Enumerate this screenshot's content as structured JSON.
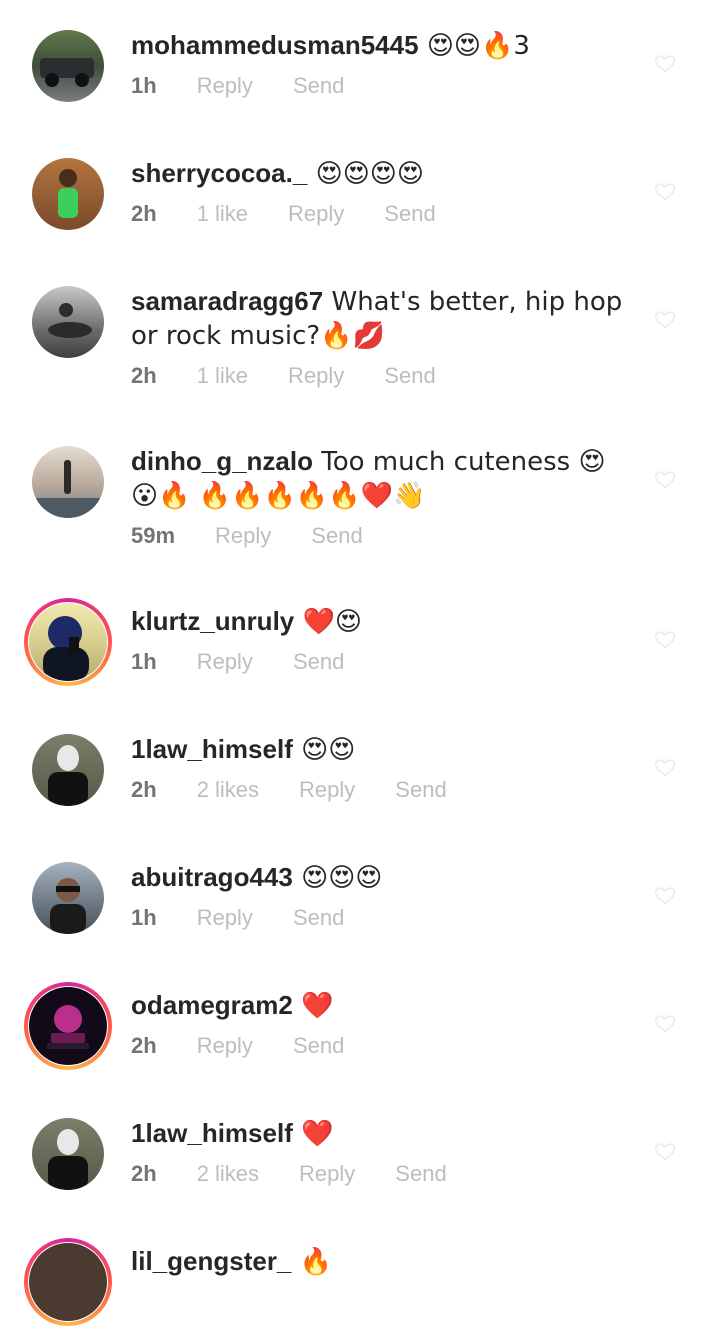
{
  "comments": [
    {
      "username": "mohammedusman5445",
      "text": " 😍😍🔥3",
      "time": "1h",
      "likes": "",
      "reply": "Reply",
      "send": "Send"
    },
    {
      "username": "sherrycocoa._",
      "text": " 😍😍😍😍",
      "time": "2h",
      "likes": "1 like",
      "reply": "Reply",
      "send": "Send"
    },
    {
      "username": "samaradragg67",
      "text": " What's better, hip hop",
      "text2": "or rock music?🔥💋",
      "time": "2h",
      "likes": "1 like",
      "reply": "Reply",
      "send": "Send"
    },
    {
      "username": "dinho_g_nzalo",
      "text": " Too much cuteness 😍",
      "text2": "😮🔥 🔥🔥🔥🔥🔥❤️👋",
      "time": "59m",
      "likes": "",
      "reply": "Reply",
      "send": "Send"
    },
    {
      "username": "klurtz_unruly",
      "text": " ❤️😍",
      "time": "1h",
      "likes": "",
      "reply": "Reply",
      "send": "Send"
    },
    {
      "username": "1law_himself",
      "text": " 😍😍",
      "time": "2h",
      "likes": "2 likes",
      "reply": "Reply",
      "send": "Send"
    },
    {
      "username": "abuitrago443",
      "text": " 😍😍😍",
      "time": "1h",
      "likes": "",
      "reply": "Reply",
      "send": "Send"
    },
    {
      "username": "odamegram2",
      "text": " ❤️",
      "time": "2h",
      "likes": "",
      "reply": "Reply",
      "send": "Send"
    },
    {
      "username": "1law_himself",
      "text": " ❤️",
      "time": "2h",
      "likes": "2 likes",
      "reply": "Reply",
      "send": "Send"
    },
    {
      "username": "lil_gengster_",
      "text": " 🔥"
    }
  ],
  "colors": {
    "time": "#737373",
    "actions": "#bdbdbd",
    "text": "#262626"
  }
}
